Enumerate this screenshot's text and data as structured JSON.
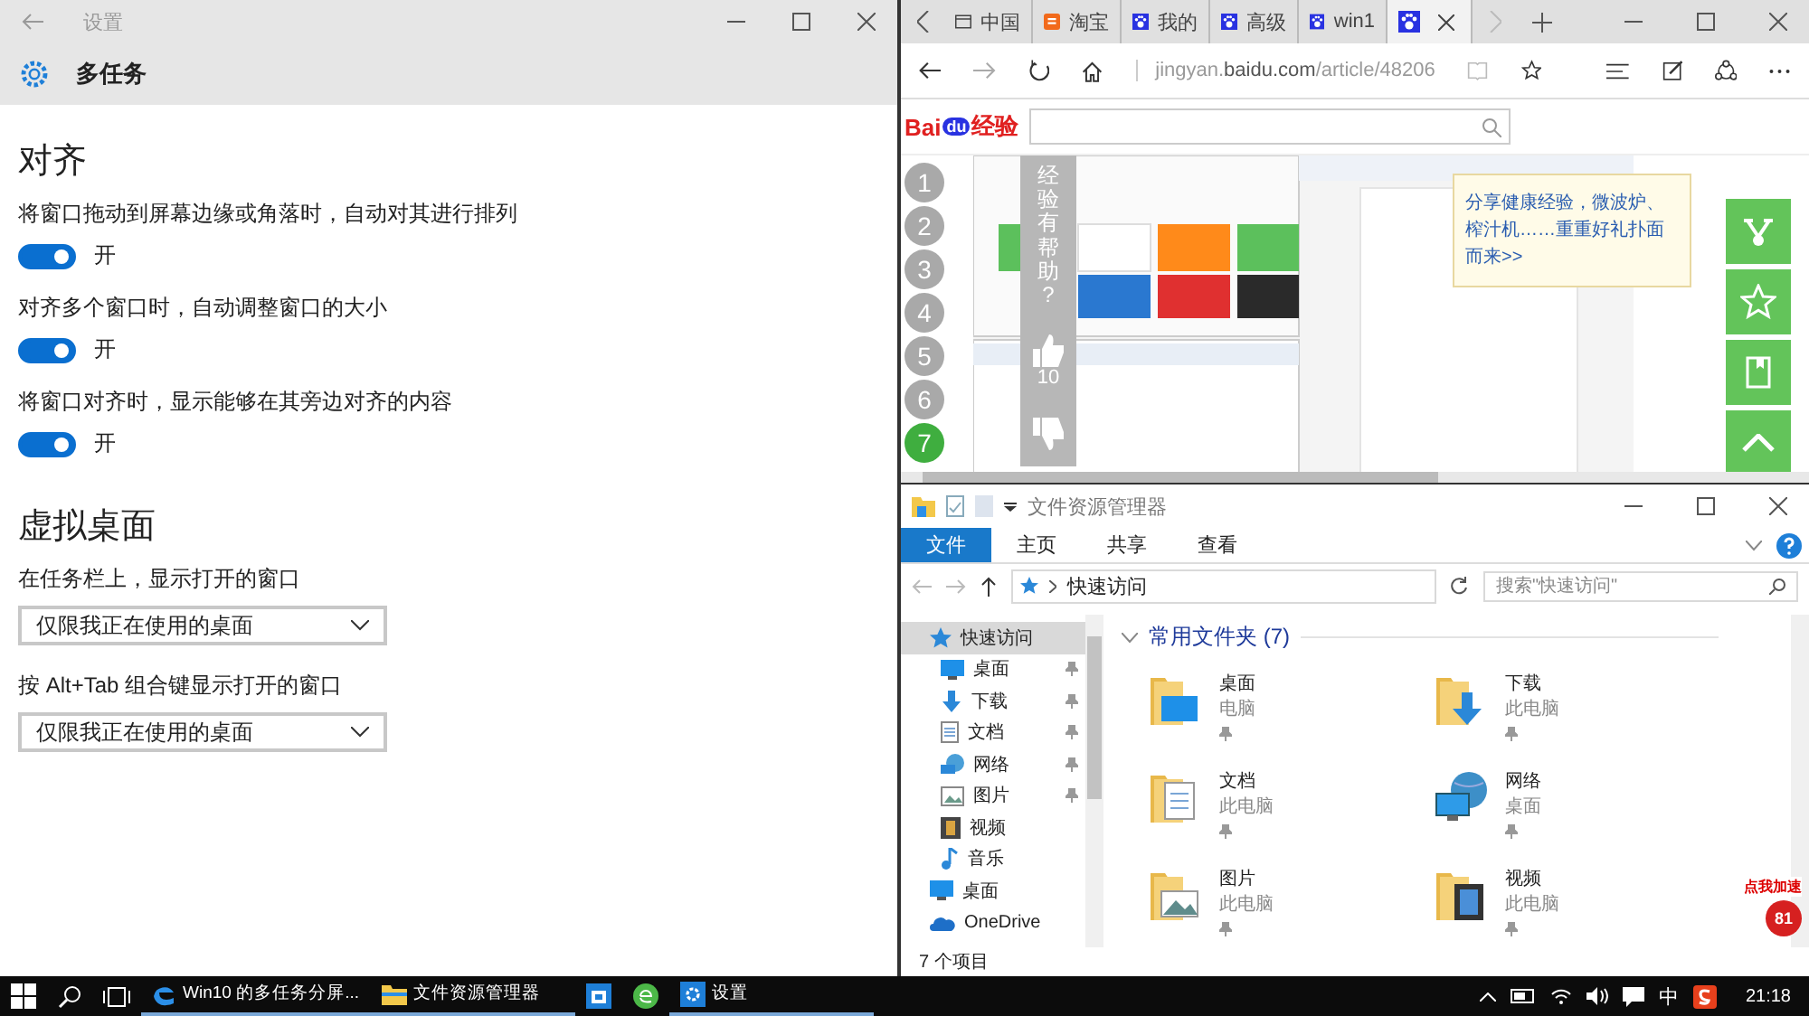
{
  "settings": {
    "title": "设置",
    "header": "多任务",
    "sections": [
      {
        "heading": "对齐",
        "items": [
          {
            "kind": "toggle",
            "label": "将窗口拖动到屏幕边缘或角落时，自动对其进行排列",
            "on": true,
            "state_text": "开"
          },
          {
            "kind": "toggle",
            "label": "对齐多个窗口时，自动调整窗口的大小",
            "on": true,
            "state_text": "开"
          },
          {
            "kind": "toggle",
            "label": "将窗口对齐时，显示能够在其旁边对齐的内容",
            "on": true,
            "state_text": "开"
          }
        ]
      },
      {
        "heading": "虚拟桌面",
        "items": [
          {
            "kind": "dropdown",
            "label": "在任务栏上，显示打开的窗口",
            "value": "仅限我正在使用的桌面"
          },
          {
            "kind": "dropdown",
            "label": "按 Alt+Tab 组合键显示打开的窗口",
            "value": "仅限我正在使用的桌面"
          }
        ]
      }
    ]
  },
  "browser": {
    "tabs": [
      {
        "kind": "page",
        "label": "中国",
        "selected": false
      },
      {
        "kind": "taobao",
        "label": "淘宝",
        "selected": false
      },
      {
        "kind": "paw",
        "label": "我的",
        "selected": false
      },
      {
        "kind": "paw",
        "label": "高级",
        "selected": false
      },
      {
        "kind": "paw",
        "label": "win1",
        "selected": false
      },
      {
        "kind": "paw",
        "selected": true
      }
    ],
    "address": {
      "host": "jingyan.",
      "domain": "baidu.com",
      "path": "/article/48206"
    },
    "logo": {
      "brand": "Bai",
      "paw": "du",
      "product": "经验"
    },
    "steps": [
      {
        "label": "1",
        "selected": false
      },
      {
        "label": "2",
        "selected": false
      },
      {
        "label": "3",
        "selected": false
      },
      {
        "label": "4",
        "selected": false
      },
      {
        "label": "5",
        "selected": false
      },
      {
        "label": "6",
        "selected": false
      },
      {
        "label": "7",
        "selected": true
      }
    ],
    "vote": {
      "question": "经验有帮助?",
      "likes": "10"
    },
    "tooltip": "分享健康经验，微波炉、榨汁机……重重好礼扑面而来>>",
    "promo": {
      "label": "点我加速",
      "badge": "81"
    }
  },
  "explorer": {
    "title": "文件资源管理器",
    "ribbon_tabs": [
      {
        "label": "文件",
        "selected": true
      },
      {
        "label": "主页",
        "selected": false
      },
      {
        "label": "共享",
        "selected": false
      },
      {
        "label": "查看",
        "selected": false
      }
    ],
    "path": "快速访问",
    "search": {
      "placeholder": "搜索\"快速访问\""
    },
    "nav": [
      {
        "kind": "quick",
        "label": "快速访问",
        "selected": true,
        "children": [
          {
            "kind": "desktop",
            "label": "桌面",
            "pinned": true
          },
          {
            "kind": "downloads",
            "label": "下载",
            "pinned": true
          },
          {
            "kind": "documents",
            "label": "文档",
            "pinned": true
          },
          {
            "kind": "network",
            "label": "网络",
            "pinned": true
          },
          {
            "kind": "pictures",
            "label": "图片",
            "pinned": true
          },
          {
            "kind": "videos",
            "label": "视频",
            "pinned": false
          },
          {
            "kind": "music",
            "label": "音乐",
            "pinned": false
          }
        ]
      },
      {
        "kind": "desktop",
        "label": "桌面",
        "selected": false
      },
      {
        "kind": "onedrive",
        "label": "OneDrive",
        "selected": false
      }
    ],
    "group": "常用文件夹 (7)",
    "folders": [
      {
        "kind": "desktop",
        "name": "桌面",
        "location": "电脑"
      },
      {
        "kind": "downloads",
        "name": "下载",
        "location": "此电脑"
      },
      {
        "kind": "documents",
        "name": "文档",
        "location": "此电脑"
      },
      {
        "kind": "network",
        "name": "网络",
        "location": "桌面"
      },
      {
        "kind": "pictures",
        "name": "图片",
        "location": "此电脑"
      },
      {
        "kind": "videos",
        "name": "视频",
        "location": "此电脑"
      }
    ],
    "status": "7 个项目"
  },
  "taskbar": {
    "items": [
      {
        "kind": "edge",
        "label": "Win10 的多任务分屏..."
      },
      {
        "kind": "explorer",
        "label": "文件资源管理器"
      },
      {
        "kind": "store"
      },
      {
        "kind": "green"
      },
      {
        "kind": "settings",
        "label": "设置"
      }
    ],
    "ime": "中",
    "clock": "21:18"
  }
}
